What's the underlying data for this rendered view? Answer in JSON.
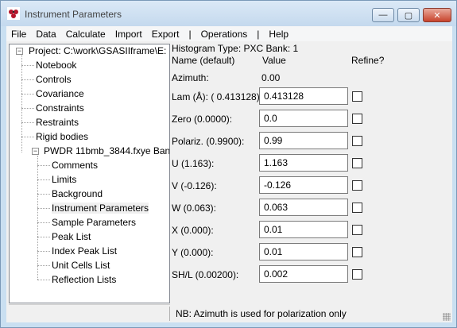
{
  "window": {
    "title": "Instrument Parameters",
    "icon": "gsas-ii-app-icon",
    "controls": {
      "minimize": "—",
      "maximize": "▢",
      "close": "✕"
    }
  },
  "menubar": {
    "items": [
      "File",
      "Data",
      "Calculate",
      "Import",
      "Export",
      "|",
      "Operations",
      "|",
      "Help"
    ]
  },
  "tree": {
    "project": "Project: C:\\work\\GSASIIframe\\E:",
    "items": [
      "Notebook",
      "Controls",
      "Covariance",
      "Constraints",
      "Restraints",
      "Rigid bodies"
    ],
    "pwdr": "PWDR 11bmb_3844.fxye Ban",
    "pwdr_children": [
      "Comments",
      "Limits",
      "Background",
      "Instrument Parameters",
      "Sample Parameters",
      "Peak List",
      "Index Peak List",
      "Unit Cells List",
      "Reflection Lists"
    ],
    "selected": "Instrument Parameters"
  },
  "header": {
    "histogram_type": "Histogram Type: PXC  Bank: 1",
    "name_col": "Name (default)",
    "value_col": "Value",
    "refine_col": "Refine?"
  },
  "azimuth": {
    "label": "Azimuth:",
    "value": "0.00"
  },
  "params": [
    {
      "label": "Lam (Å): ( 0.413128)",
      "value": "0.413128",
      "refine": false
    },
    {
      "label": "Zero (0.0000):",
      "value": "0.0",
      "refine": false
    },
    {
      "label": "Polariz. (0.9900):",
      "value": "0.99",
      "refine": false
    },
    {
      "label": "U (1.163):",
      "value": "1.163",
      "refine": false
    },
    {
      "label": "V (-0.126):",
      "value": "-0.126",
      "refine": false
    },
    {
      "label": "W (0.063):",
      "value": "0.063",
      "refine": false
    },
    {
      "label": "X (0.000):",
      "value": "0.01",
      "refine": false
    },
    {
      "label": "Y (0.000):",
      "value": "0.01",
      "refine": false
    },
    {
      "label": "SH/L (0.00200):",
      "value": "0.002",
      "refine": false
    }
  ],
  "status": {
    "message": "NB: Azimuth is used for polarization only"
  }
}
